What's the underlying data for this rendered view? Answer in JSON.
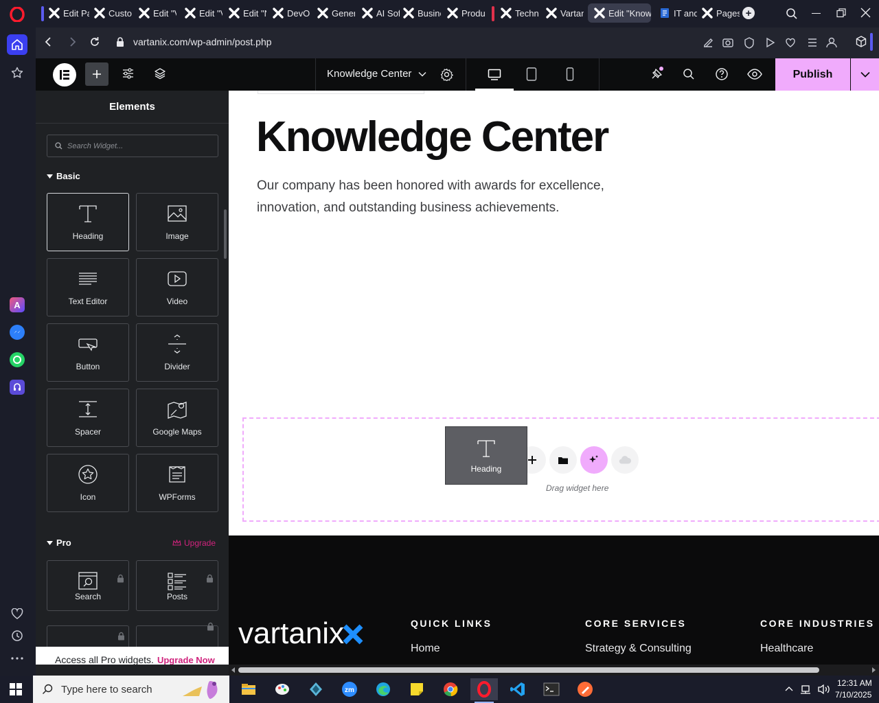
{
  "browser": {
    "tabs": [
      {
        "label": "Edit Pa",
        "icon": "elementor-x-icon"
      },
      {
        "label": "Custor",
        "icon": "elementor-x-icon"
      },
      {
        "label": "Edit \"V",
        "icon": "elementor-x-icon"
      },
      {
        "label": "Edit \"V",
        "icon": "elementor-x-icon"
      },
      {
        "label": "Edit \"N",
        "icon": "elementor-x-icon"
      },
      {
        "label": "DevOp",
        "icon": "elementor-x-icon"
      },
      {
        "label": "Gener",
        "icon": "elementor-x-icon"
      },
      {
        "label": "AI Sof",
        "icon": "elementor-x-icon"
      },
      {
        "label": "Busine",
        "icon": "elementor-x-icon"
      },
      {
        "label": "Produ",
        "icon": "elementor-x-icon"
      },
      {
        "label": "Techno",
        "icon": "elementor-x-icon"
      },
      {
        "label": "Vartan",
        "icon": "elementor-x-icon"
      },
      {
        "label": "Edit \"Knowle",
        "icon": "elementor-x-icon",
        "active": true
      },
      {
        "label": "IT and",
        "icon": "page-icon"
      },
      {
        "label": "Pages",
        "icon": "elementor-x-icon"
      }
    ],
    "url": "vartanix.com/wp-admin/post.php"
  },
  "editor": {
    "page_name": "Knowledge Center",
    "publish_label": "Publish",
    "panel_title": "Elements",
    "search_placeholder": "Search Widget...",
    "basic_section": "Basic",
    "pro_section": "Pro",
    "upgrade_label": "Upgrade",
    "basic_widgets": [
      {
        "label": "Heading",
        "icon": "heading-icon",
        "selected": true
      },
      {
        "label": "Image",
        "icon": "image-icon"
      },
      {
        "label": "Text Editor",
        "icon": "text-editor-icon"
      },
      {
        "label": "Video",
        "icon": "video-icon"
      },
      {
        "label": "Button",
        "icon": "button-icon"
      },
      {
        "label": "Divider",
        "icon": "divider-icon"
      },
      {
        "label": "Spacer",
        "icon": "spacer-icon"
      },
      {
        "label": "Google Maps",
        "icon": "map-icon"
      },
      {
        "label": "Icon",
        "icon": "star-icon"
      },
      {
        "label": "WPForms",
        "icon": "wpforms-icon"
      }
    ],
    "pro_widgets": [
      {
        "label": "Search",
        "icon": "search-widget-icon"
      },
      {
        "label": "Posts",
        "icon": "posts-icon"
      }
    ],
    "pro_banner_text": "Access all Pro widgets.",
    "pro_banner_link": "Upgrade Now"
  },
  "canvas": {
    "heading": "Knowledge Center",
    "description": "Our company has been honored with awards for excellence, innovation, and outstanding business achievements.",
    "drag_hint": "Drag widget here",
    "dragging_widget": "Heading"
  },
  "footer": {
    "logo_text": "vartanix",
    "columns": [
      {
        "title": "QUICK LINKS",
        "item": "Home"
      },
      {
        "title": "CORE SERVICES",
        "item": "Strategy & Consulting"
      },
      {
        "title": "CORE INDUSTRIES",
        "item": "Healthcare"
      }
    ]
  },
  "taskbar": {
    "search_placeholder": "Type here to search",
    "time": "12:31 AM",
    "date": "7/10/2025"
  },
  "colors": {
    "accent_pink": "#f0abfc",
    "upgrade_pink": "#d0237d",
    "panel_bg": "#1f2124",
    "topbar_bg": "#0c0d0e"
  }
}
